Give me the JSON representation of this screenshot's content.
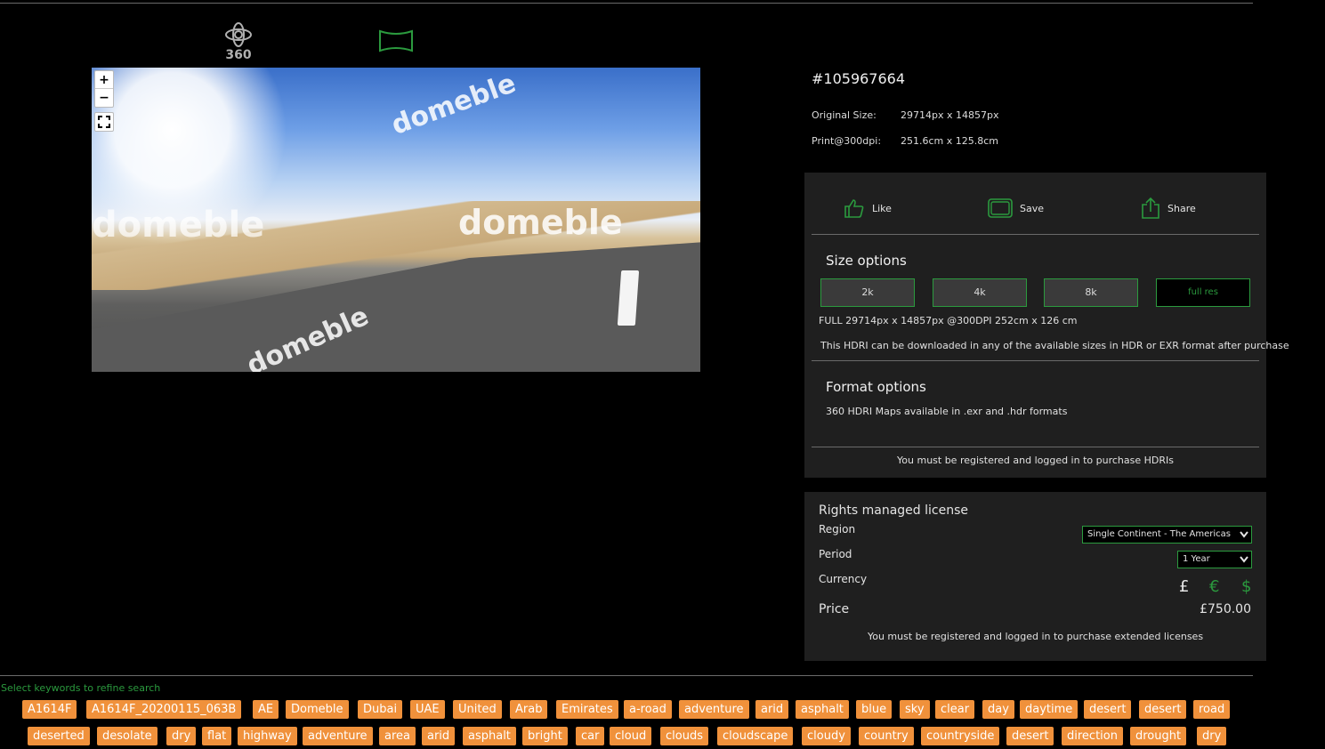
{
  "viewer": {
    "mode_360_label": "360",
    "zoom_in": "+",
    "zoom_out": "−",
    "watermark": "domeble"
  },
  "image": {
    "id": "#105967664",
    "original_size_label": "Original Size:",
    "original_size_value": "29714px x 14857px",
    "print_label": "Print@300dpi:",
    "print_value": "251.6cm x 125.8cm"
  },
  "actions": {
    "like": "Like",
    "save": "Save",
    "share": "Share"
  },
  "size_options": {
    "title": "Size options",
    "buttons": [
      "2k",
      "4k",
      "8k",
      "full res"
    ],
    "selected": "full res",
    "detail": "FULL 29714px x 14857px @300DPI 252cm x 126 cm",
    "note": "This HDRI can be downloaded in any of the available sizes in HDR or EXR format after purchase"
  },
  "format_options": {
    "title": "Format options",
    "text": "360 HDRI Maps available in .exr and .hdr formats"
  },
  "purchase_notice": "You must be registered and logged in to purchase HDRIs",
  "license": {
    "title": "Rights managed license",
    "region_label": "Region",
    "region_value": "Single Continent - The Americas",
    "period_label": "Period",
    "period_value": "1 Year",
    "currency_label": "Currency",
    "currencies": [
      "£",
      "€",
      "$"
    ],
    "selected_currency": "£",
    "price_label": "Price",
    "price_value": "£750.00",
    "notice": "You must be registered and logged in to purchase extended licenses"
  },
  "keywords": {
    "hint": "Select keywords to refine search",
    "row1": [
      "A1614F",
      "A1614F_20200115_063B",
      "AE",
      "Domeble",
      "Dubai",
      "UAE",
      "United",
      "Arab",
      "Emirates",
      "a-road",
      "adventure",
      "arid",
      "asphalt",
      "blue",
      "sky",
      "clear",
      "day",
      "daytime",
      "desert",
      "desert",
      "road"
    ],
    "row2": [
      "deserted",
      "desolate",
      "dry",
      "flat",
      "highway",
      "adventure",
      "area",
      "arid",
      "asphalt",
      "bright",
      "car",
      "cloud",
      "clouds",
      "cloudscape",
      "cloudy",
      "country",
      "countryside",
      "desert",
      "direction",
      "drought",
      "dry"
    ]
  },
  "colors": {
    "accent": "#2b9a3e",
    "tag": "#f0913b",
    "panel": "#1f1f1f"
  }
}
